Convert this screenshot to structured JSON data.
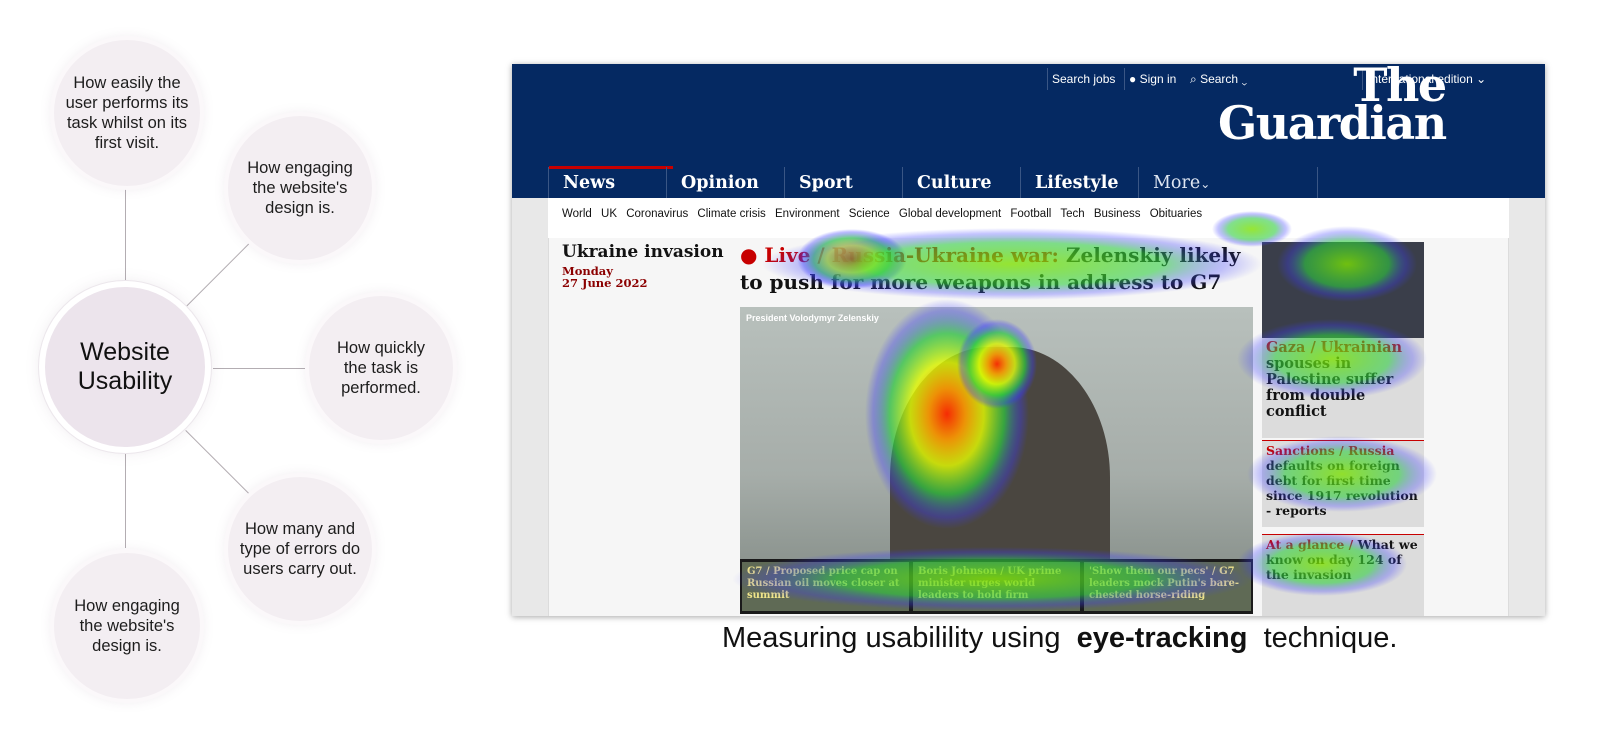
{
  "diagram": {
    "center": "Website\nUsability",
    "nodes": [
      "How easily the user performs its task whilst on its first visit.",
      "How engaging the website's design is.",
      "How quickly the task is performed.",
      "How many and type of errors do users carry out.",
      "How engaging the website's design is."
    ]
  },
  "screenshot": {
    "top_links": [
      "Search jobs",
      "Sign in",
      "Search",
      "International edition"
    ],
    "logo_line1": "The",
    "logo_line2": "Guardian",
    "nav": [
      "News",
      "Opinion",
      "Sport",
      "Culture",
      "Lifestyle",
      "More"
    ],
    "sublinks": [
      "World",
      "UK",
      "Coronavirus",
      "Climate crisis",
      "Environment",
      "Science",
      "Global development",
      "Football",
      "Tech",
      "Business",
      "Obituaries"
    ],
    "section": "Ukraine invasion",
    "day": "Monday",
    "date": "27 June 2022",
    "headline_kicker": "Live / Russia-Ukraine war:",
    "headline": "Zelenskiy likely to push for more weapons in address to G7",
    "photo_caption": "President Volodymyr Zelenskiy",
    "sub_cards": [
      "G7 / Proposed price cap on Russian oil moves closer at summit",
      "Boris Johnson / UK prime minister urges world leaders to hold firm",
      "'Show them our pecs' / G7 leaders mock Putin's bare-chested horse-riding"
    ],
    "right_stories": [
      {
        "kicker": "Gaza / Ukrainian",
        "title": "spouses in Palestine suffer from double conflict"
      },
      {
        "kicker": "Sanctions / Russia",
        "title": "defaults on foreign debt for first time since 1917 revolution - reports"
      },
      {
        "kicker": "At a glance /",
        "title": "What we know on day 124 of the invasion"
      }
    ],
    "colors": {
      "header": "#052962",
      "accent": "#c70000"
    }
  },
  "caption": {
    "prefix": "Measuring usabilility using",
    "bold": "eye-tracking",
    "suffix": "technique."
  }
}
